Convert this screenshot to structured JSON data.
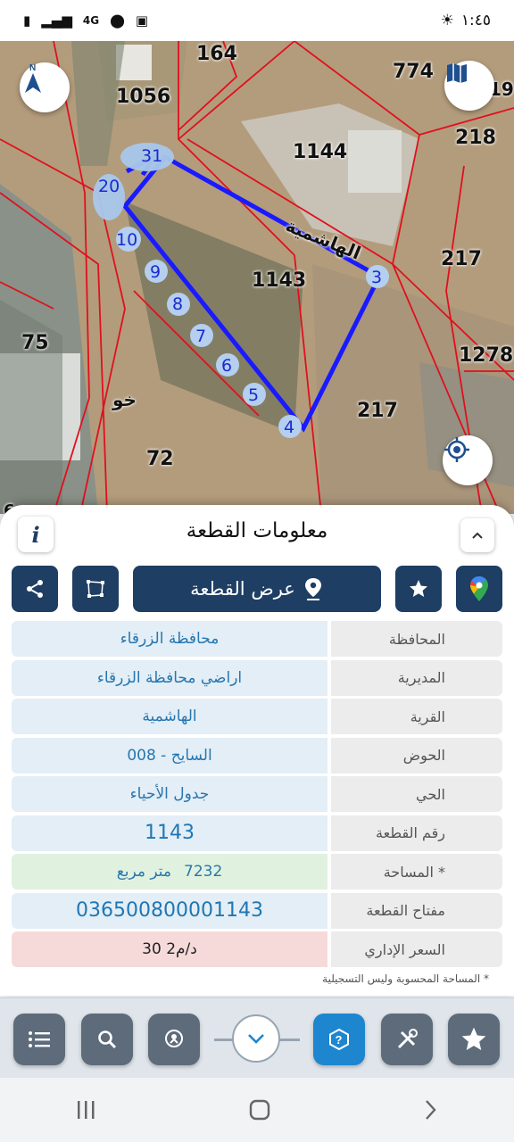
{
  "status_bar": {
    "time": "١:٤٥",
    "network": "4G"
  },
  "map": {
    "parcel_labels": [
      "164",
      "774",
      "19",
      "1056",
      "218",
      "1144",
      "217",
      "1143",
      "1278",
      "217",
      "75",
      "72",
      "6"
    ],
    "street_label": "الهاشمية",
    "area_label": "خو",
    "vertex_labels": [
      "31",
      "20",
      "10",
      "9",
      "8",
      "7",
      "6",
      "5",
      "4",
      "3"
    ],
    "colors": {
      "parcel_outline": "#1a1aff",
      "parcel_lines": "#e0101e",
      "vertex_fill": "#a9c8ec"
    }
  },
  "panel": {
    "title": "معلومات القطعة",
    "view_button_label": "عرض القطعة",
    "rows": [
      {
        "label": "المحافظة",
        "value": "محافظة الزرقاء"
      },
      {
        "label": "المديرية",
        "value": "اراضي محافظة الزرقاء"
      },
      {
        "label": "القرية",
        "value": "الهاشمية"
      },
      {
        "label": "الحوض",
        "value": "السايح - 008"
      },
      {
        "label": "الحي",
        "value": "جدول الأحياء"
      },
      {
        "label": "رقم القطعة",
        "value": "1143"
      },
      {
        "label": "المساحة *",
        "value_number": "7232",
        "value_unit": "متر مربع"
      },
      {
        "label": "مفتاح القطعة",
        "value": "036500800001143"
      },
      {
        "label": "السعر الإداري",
        "value": "30 د/م2"
      }
    ],
    "footnote": "* المساحة المحسوبة وليس التسجيلية"
  },
  "accent_colors": {
    "primary": "#1e3e63",
    "help": "#1d86cf"
  }
}
